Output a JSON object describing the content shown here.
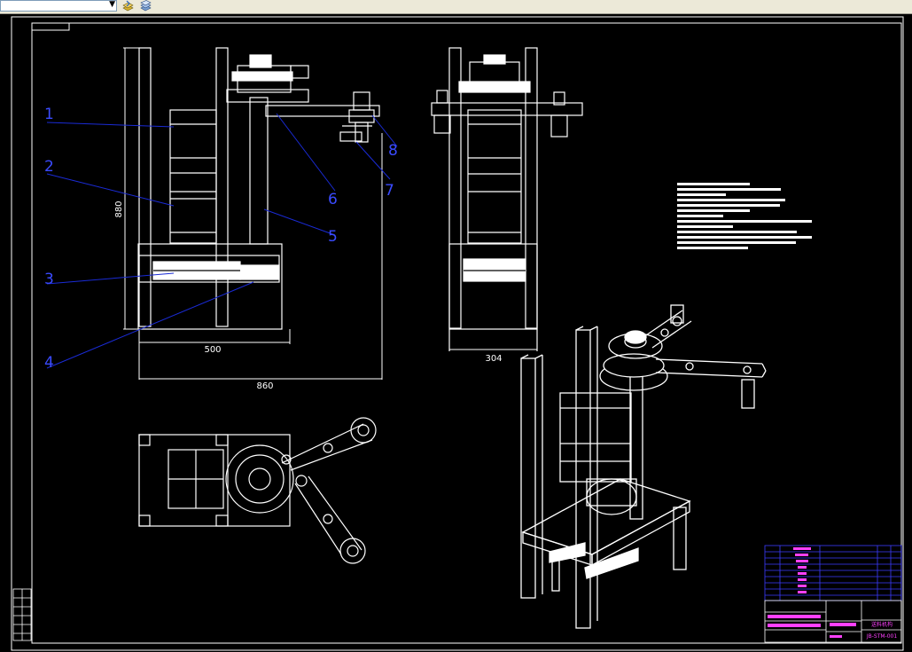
{
  "toolbar": {
    "layer_combo_value": "",
    "icons": [
      "layer-states-icon",
      "layer-previous-icon"
    ]
  },
  "drawing": {
    "callouts": [
      "1",
      "2",
      "3",
      "4",
      "5",
      "6",
      "7",
      "8"
    ],
    "dimensions": {
      "height_label": "880",
      "base_width_label": "500",
      "overall_width_label": "860",
      "side_width_label": "304"
    },
    "title_block": {
      "drawing_number": "JB-STM-001",
      "drawing_name": "送料机构"
    }
  },
  "colors": {
    "background": "#000000",
    "lines": "#ffffff",
    "leaders": "#1a2bd6",
    "callout_text": "#3a4bff",
    "title_block": "#3b3bff",
    "title_text": "#ff40ff"
  }
}
